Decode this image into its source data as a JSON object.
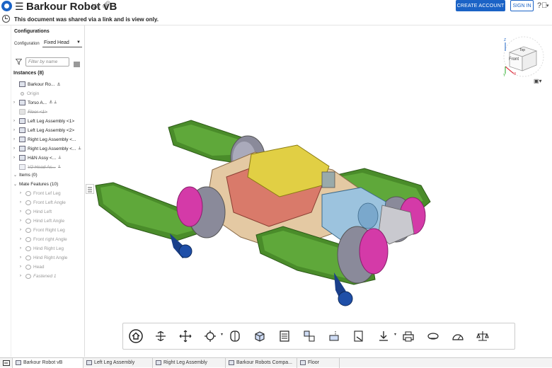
{
  "header": {
    "title": "Barkour Robot vB",
    "version": "V4",
    "create_account": "CREATE ACCOUNT",
    "sign_in": "SIGN IN"
  },
  "info": {
    "share_message": "This document was shared via a link and is view only."
  },
  "panel": {
    "configurations_title": "Configurations",
    "configuration_label": "Configuration",
    "configuration_value": "Fixed Head",
    "filter_placeholder": "Filter by name",
    "instances_header": "Instances (8)",
    "items_header": "Items (0)",
    "mate_header": "Mate Features (10)",
    "instances": [
      {
        "label": "Barkour Ro...",
        "icon": "assembly-icon",
        "style": "normal",
        "expandable": false
      },
      {
        "label": "Origin",
        "icon": "origin-icon",
        "style": "dim",
        "expandable": false
      },
      {
        "label": "Torso A...",
        "icon": "assembly-icon",
        "style": "normal",
        "expandable": true
      },
      {
        "label": "Floor <1>",
        "icon": "part-icon",
        "style": "strike",
        "expandable": false
      },
      {
        "label": "Left Leg Assembly <1>",
        "icon": "assembly-icon",
        "style": "normal",
        "expandable": true
      },
      {
        "label": "Left Leg Assembly <2>",
        "icon": "assembly-icon",
        "style": "normal",
        "expandable": true
      },
      {
        "label": "Right Leg Assembly <...",
        "icon": "assembly-icon",
        "style": "normal",
        "expandable": true
      },
      {
        "label": "Right Leg Assembly <...",
        "icon": "assembly-icon",
        "style": "normal",
        "expandable": true
      },
      {
        "label": "H&N Assy <...",
        "icon": "assembly-icon",
        "style": "normal",
        "expandable": true
      },
      {
        "label": "V2 Head As...",
        "icon": "assembly-icon",
        "style": "strike",
        "expandable": false
      }
    ],
    "mates": [
      "Front Lef Leg",
      "Front Left Angle",
      "Hind Left",
      "Hind Left Angle",
      "Front Right Leg",
      "Front right Angle",
      "Hind Right Leg",
      "Hind Right Angle",
      "Head",
      "Fastened 1"
    ]
  },
  "viewcube": {
    "front": "Front",
    "top": "Top",
    "axis_x": "X",
    "axis_y": "Y",
    "axis_z": "Z"
  },
  "toolbar": {
    "tools": [
      "home-icon",
      "rotate-icon",
      "pan-icon",
      "explode-icon",
      "section-icon",
      "render-icon",
      "bom-icon",
      "configure-icon",
      "measure-icon",
      "drawing-icon",
      "export-icon",
      "print-icon",
      "tape-icon",
      "protractor-icon",
      "mass-icon"
    ]
  },
  "tabs": [
    {
      "label": "Barkour Robot vB",
      "active": true
    },
    {
      "label": "Left Leg Assembly",
      "active": false
    },
    {
      "label": "Right Leg Assembly",
      "active": false
    },
    {
      "label": "Barkour Robots Compa...",
      "active": false
    },
    {
      "label": "Floor",
      "active": false
    }
  ]
}
